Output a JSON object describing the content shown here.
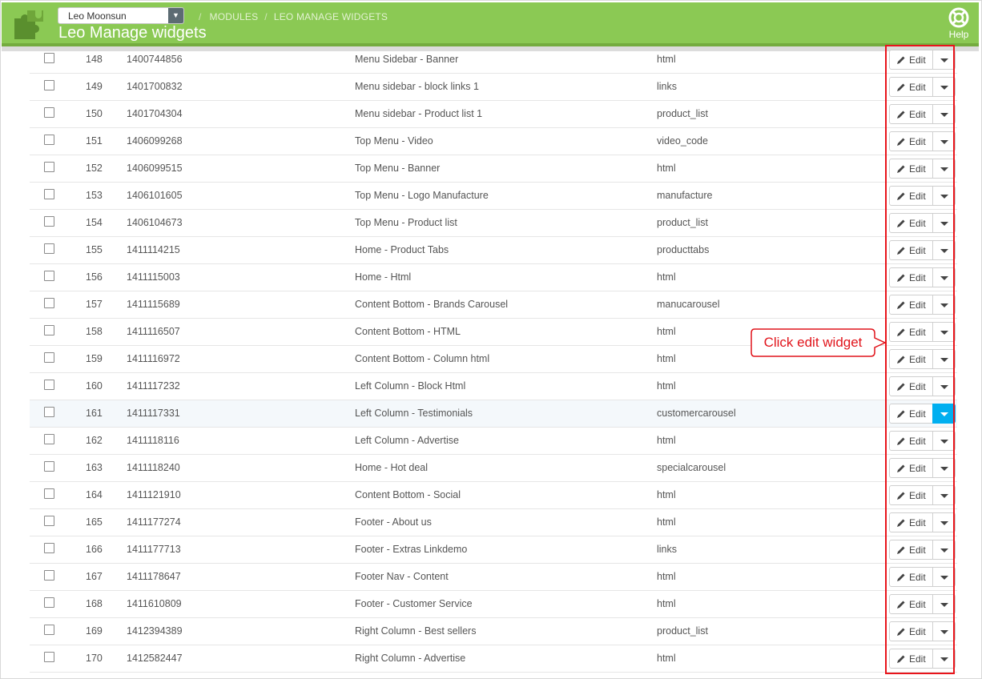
{
  "header": {
    "shop_select": "Leo Moonsun",
    "breadcrumb": [
      "MODULES",
      "LEO MANAGE WIDGETS"
    ],
    "breadcrumb_separator": "/",
    "page_title": "Leo Manage widgets",
    "help_label": "Help"
  },
  "colors": {
    "header_bg": "#8bc954",
    "active_dropdown": "#00aff0",
    "annotation_red": "#e1141b"
  },
  "annotation": {
    "text": "Click edit widget"
  },
  "table": {
    "edit_label": "Edit",
    "rows": [
      {
        "id": "148",
        "key": "1400744856",
        "name": "Menu Sidebar - Banner",
        "type": "html"
      },
      {
        "id": "149",
        "key": "1401700832",
        "name": "Menu sidebar - block links 1",
        "type": "links"
      },
      {
        "id": "150",
        "key": "1401704304",
        "name": "Menu sidebar - Product list 1",
        "type": "product_list"
      },
      {
        "id": "151",
        "key": "1406099268",
        "name": "Top Menu - Video",
        "type": "video_code"
      },
      {
        "id": "152",
        "key": "1406099515",
        "name": "Top Menu - Banner",
        "type": "html"
      },
      {
        "id": "153",
        "key": "1406101605",
        "name": "Top Menu - Logo Manufacture",
        "type": "manufacture"
      },
      {
        "id": "154",
        "key": "1406104673",
        "name": "Top Menu - Product list",
        "type": "product_list"
      },
      {
        "id": "155",
        "key": "1411114215",
        "name": "Home - Product Tabs",
        "type": "producttabs"
      },
      {
        "id": "156",
        "key": "1411115003",
        "name": "Home - Html",
        "type": "html"
      },
      {
        "id": "157",
        "key": "1411115689",
        "name": "Content Bottom - Brands Carousel",
        "type": "manucarousel"
      },
      {
        "id": "158",
        "key": "1411116507",
        "name": "Content Bottom - HTML",
        "type": "html"
      },
      {
        "id": "159",
        "key": "1411116972",
        "name": "Content Bottom - Column html",
        "type": "html"
      },
      {
        "id": "160",
        "key": "1411117232",
        "name": "Left Column - Block Html",
        "type": "html"
      },
      {
        "id": "161",
        "key": "1411117331",
        "name": "Left Column - Testimonials",
        "type": "customercarousel",
        "highlighted": true
      },
      {
        "id": "162",
        "key": "1411118116",
        "name": "Left Column - Advertise",
        "type": "html"
      },
      {
        "id": "163",
        "key": "1411118240",
        "name": "Home - Hot deal",
        "type": "specialcarousel"
      },
      {
        "id": "164",
        "key": "1411121910",
        "name": "Content Bottom - Social",
        "type": "html"
      },
      {
        "id": "165",
        "key": "1411177274",
        "name": "Footer - About us",
        "type": "html"
      },
      {
        "id": "166",
        "key": "1411177713",
        "name": "Footer - Extras Linkdemo",
        "type": "links"
      },
      {
        "id": "167",
        "key": "1411178647",
        "name": "Footer Nav - Content",
        "type": "html"
      },
      {
        "id": "168",
        "key": "1411610809",
        "name": "Footer - Customer Service",
        "type": "html"
      },
      {
        "id": "169",
        "key": "1412394389",
        "name": "Right Column - Best sellers",
        "type": "product_list"
      },
      {
        "id": "170",
        "key": "1412582447",
        "name": "Right Column - Advertise",
        "type": "html"
      }
    ]
  }
}
